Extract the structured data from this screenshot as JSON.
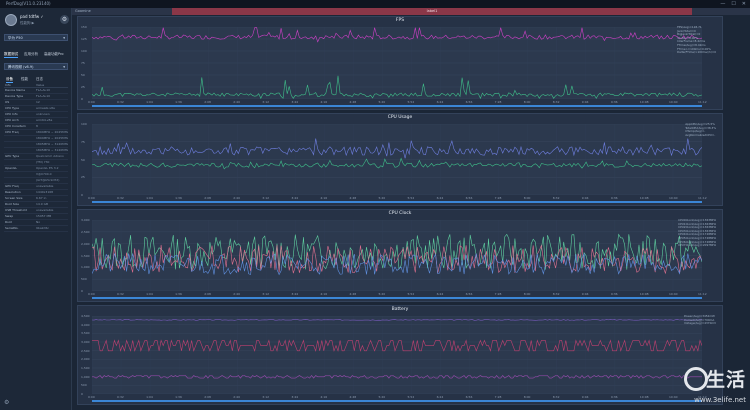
{
  "window": {
    "title": "PerfDog(V11.0.23140)",
    "controls": [
      "—",
      "☐",
      "✕"
    ]
  },
  "sidebar": {
    "user_name": "pad tdtfw ✓",
    "user_sub": "性能狗 ▶",
    "device_select": "华为 P50",
    "tabs_a": [
      "数据测试",
      "应用分析",
      "高级功能Pro"
    ],
    "app_select": "腾讯视频 (v8.9)",
    "tabs_b": [
      "设备",
      "性能",
      "日志"
    ],
    "info_header": [
      "Info",
      "Value"
    ],
    "info_rows": [
      [
        "Device Name",
        "FLA-AL10"
      ],
      [
        "Device Type",
        "FLA-AL10"
      ],
      [
        "OS",
        "12"
      ],
      [
        "CPU Type",
        "armeabi-v8a"
      ],
      [
        "CPU Info",
        "unknown"
      ],
      [
        "CPU Arch",
        "arm64-v8a"
      ],
      [
        "CPU Coreitem",
        "8"
      ],
      [
        "CPU Freq",
        "1804MHz ~ 2045MHz"
      ],
      [
        "",
        "1804MHz ~ 2045MHz"
      ],
      [
        "",
        "1805MHz ~ 3140MHz"
      ],
      [
        "",
        "1805MHz ~ 3140MHz"
      ],
      [
        "GPU Type",
        "Qualcomm Adreno"
      ],
      [
        "",
        "(TM) 730"
      ],
      [
        "OpenGL",
        "OpenGL ES 3.2"
      ],
      [
        "",
        "V@0700.0"
      ],
      [
        "",
        "(GIT@b5c9d7d)"
      ],
      [
        "GPU Freq",
        "unavailable"
      ],
      [
        "Resolution",
        "1440x3168"
      ],
      [
        "Screen Size",
        "6.67 in"
      ],
      [
        "Root Size",
        "14.9 GB"
      ],
      [
        "USB Threshold",
        "unavailable"
      ],
      [
        "Swap",
        "15957 MB"
      ],
      [
        "Root",
        "No"
      ],
      [
        "SerialNo.",
        "9ba2d6c"
      ]
    ],
    "footer_icon": "settings-icon"
  },
  "topbar": {
    "tag": "Goamine",
    "label": "label1"
  },
  "panels": [
    {
      "title": "FPS",
      "y_ticks": [
        "150",
        "125",
        "100",
        "75",
        "50",
        "25",
        "0"
      ],
      "y_unit": "FPS",
      "legend": [
        "FPS(Avg)=118.71",
        "Jank(Total)=0",
        "BigJank(Total)=0",
        "Stutter=0.00%",
        "InterFrame=8.42ms",
        "FTime(Avg)=8.42ms",
        "FTime>=100ms=0.00%",
        "Delta(FTime)>100ms(/h)=0"
      ],
      "x_ticks": [
        "0:00",
        "0:32",
        "1:04",
        "1:36",
        "2:08",
        "2:40",
        "3:12",
        "3:44",
        "4:16",
        "4:48",
        "5:20",
        "5:52",
        "6:24",
        "6:56",
        "7:28",
        "8:00",
        "8:32",
        "9:04",
        "9:36",
        "10:08",
        "10:40",
        "11:12"
      ]
    },
    {
      "title": "CPU Usage",
      "y_ticks": [
        "100",
        "75",
        "50",
        "25",
        "0"
      ],
      "y_unit": "%",
      "legend": [
        "AppCPU(Avg)=25.5%",
        "TotalCPU(Avg)=38.3%",
        "CTemp(Avg)=-",
        "AvgNormalizedCPU=-"
      ],
      "x_ticks": [
        "0:00",
        "0:32",
        "1:04",
        "1:36",
        "2:08",
        "2:40",
        "3:12",
        "3:44",
        "4:16",
        "4:48",
        "5:20",
        "5:52",
        "6:24",
        "6:56",
        "7:28",
        "8:00",
        "8:32",
        "9:04",
        "9:36",
        "10:08",
        "10:40",
        "11:12"
      ]
    },
    {
      "title": "CPU Clock",
      "y_ticks": [
        "3,000",
        "2,500",
        "2,000",
        "1,500",
        "1,000",
        "500",
        "0"
      ],
      "y_unit": "MHz",
      "legend": [
        "CPU0Clock(Avg)=1363MHz",
        "CPU1Clock(Avg)=1363MHz",
        "CPU2Clock(Avg)=1363MHz",
        "CPU3Clock(Avg)=1363MHz",
        "CPU4Clock(Avg)=1728MHz",
        "CPU5Clock(Avg)=1728MHz",
        "CPU6Clock(Avg)=1728MHz",
        "CPU7Clock(Avg)=2097MHz"
      ],
      "x_ticks": [
        "0:00",
        "0:32",
        "1:04",
        "1:36",
        "2:08",
        "2:40",
        "3:12",
        "3:44",
        "4:16",
        "4:48",
        "5:20",
        "5:52",
        "6:24",
        "6:56",
        "7:28",
        "8:00",
        "8:32",
        "9:04",
        "9:36",
        "10:08",
        "10:40",
        "11:12"
      ]
    },
    {
      "title": "Battery",
      "y_ticks": [
        "4,500",
        "4,000",
        "3,500",
        "3,000",
        "2,500",
        "2,000",
        "1,500",
        "1,000",
        "500",
        "0"
      ],
      "y_unit": "mW",
      "legend": [
        "Power(Avg)=3452mW",
        "Current(Avg)=790mA",
        "Voltage(Avg)=4370mV"
      ],
      "x_ticks": [
        "0:00",
        "0:32",
        "1:04",
        "1:36",
        "2:08",
        "2:40",
        "3:12",
        "3:44",
        "4:16",
        "4:48",
        "5:20",
        "5:52",
        "6:24",
        "6:56",
        "7:28",
        "8:00",
        "8:32",
        "9:04",
        "9:36",
        "10:08",
        "10:40",
        "11:12"
      ]
    }
  ],
  "colors": {
    "fps": "#d040c8",
    "jank": "#3fbf8a",
    "cpu_app": "#3fbf8a",
    "cpu_total": "#6f7fe0",
    "clock_a": "#e07090",
    "clock_b": "#5fd0a0",
    "clock_c": "#6090e0",
    "battery": "#c04070",
    "scroll": "#3b86d6"
  },
  "watermark": {
    "text": "生活",
    "url": "www.3elife.net"
  }
}
